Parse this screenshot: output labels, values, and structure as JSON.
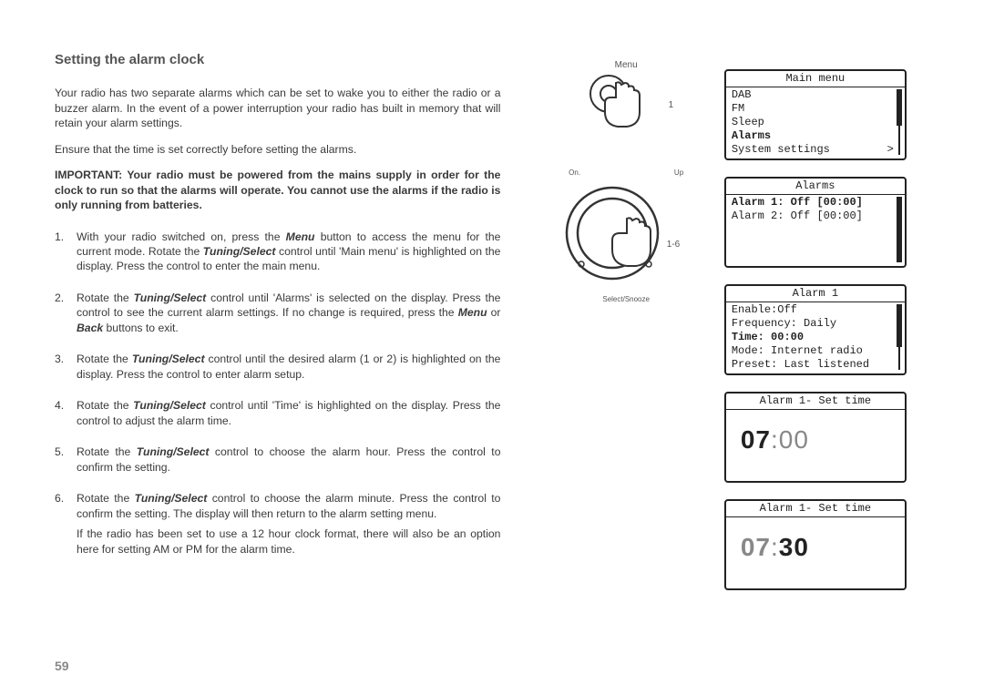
{
  "title": "Setting the alarm clock",
  "intro": {
    "p1": "Your radio has two separate alarms which can be set to wake you to either the radio or a buzzer alarm. In the event of a power interruption your radio has built in memory that will retain your alarm settings.",
    "p2": "Ensure that the time is set correctly before setting the alarms."
  },
  "important": "IMPORTANT: Your radio must be powered from the mains supply in order for the clock to run so that the alarms will operate. You cannot use the alarms if the radio is only running from batteries.",
  "steps": [
    {
      "parts": [
        "With your radio switched on, press the ",
        "Menu",
        " button to access the menu for the current mode. Rotate the ",
        "Tuning/Select",
        " control until 'Main menu' is highlighted on the display. Press the control to enter the main menu."
      ]
    },
    {
      "parts": [
        "Rotate the ",
        "Tuning/Select",
        " control until 'Alarms' is selected on the display. Press the control to see the current alarm settings. If no change is required, press the ",
        "Menu",
        " or ",
        "Back",
        " buttons to exit."
      ]
    },
    {
      "parts": [
        "Rotate the ",
        "Tuning/Select",
        " control until the desired alarm (1 or 2) is highlighted on the display. Press the control to enter alarm setup."
      ]
    },
    {
      "parts": [
        "Rotate the ",
        "Tuning/Select",
        " control until 'Time' is highlighted on the display. Press the control to adjust the alarm time."
      ]
    },
    {
      "parts": [
        "Rotate the ",
        "Tuning/Select",
        " control to choose the alarm hour. Press the control to confirm the setting."
      ]
    },
    {
      "parts": [
        "Rotate the ",
        "Tuning/Select",
        " control to choose the alarm minute. Press the control to confirm the setting. The display will then return to the alarm setting menu."
      ],
      "extra": "If the radio has been set to use a 12 hour clock format, there will also be an option here for setting AM or PM for the alarm time."
    }
  ],
  "pageNumber": "59",
  "illus1": {
    "top": "Menu",
    "step": "1"
  },
  "illus2": {
    "left": "On.",
    "right": "Up",
    "bottom": "Select/Snooze",
    "step": "1-6"
  },
  "screens": {
    "mainMenu": {
      "header": "Main menu",
      "items": [
        {
          "label": "DAB"
        },
        {
          "label": "FM"
        },
        {
          "label": "Sleep"
        },
        {
          "label": "Alarms",
          "bold": true
        },
        {
          "label": "System settings",
          "arrow": ">"
        }
      ]
    },
    "alarms": {
      "header": "Alarms",
      "items": [
        {
          "label": "Alarm 1: Off [00:00]",
          "bold": true
        },
        {
          "label": "Alarm 2: Off [00:00]"
        }
      ]
    },
    "alarm1": {
      "header": "Alarm 1",
      "items": [
        {
          "label": "Enable:Off"
        },
        {
          "label": "Frequency: Daily"
        },
        {
          "label": "Time: 00:00",
          "bold": true
        },
        {
          "label": "Mode: Internet radio"
        },
        {
          "label": "Preset: Last listened"
        }
      ]
    },
    "setTime1": {
      "header": "Alarm 1- Set time",
      "hh": "07",
      "sep": ":",
      "mm": "00"
    },
    "setTime2": {
      "header": "Alarm 1- Set time",
      "hh": "07",
      "sep": ":",
      "mm": "30"
    }
  }
}
